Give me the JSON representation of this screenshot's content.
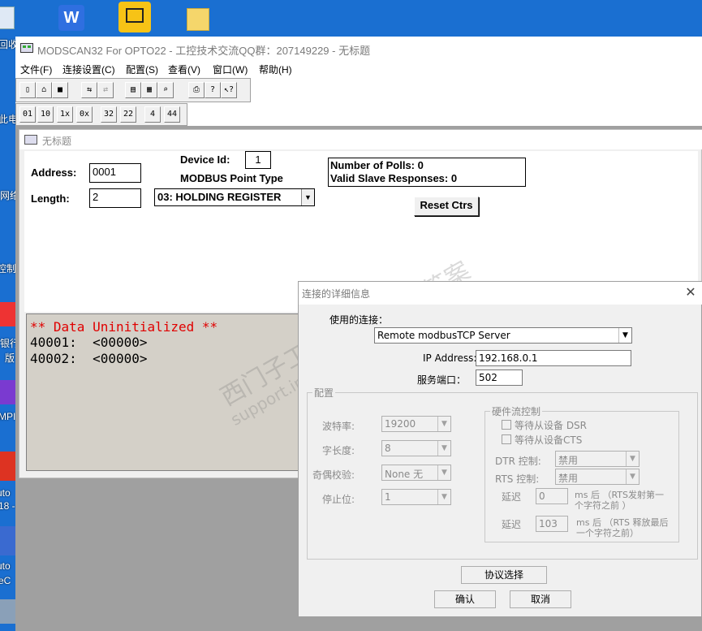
{
  "app": {
    "title": "MODSCAN32 For OPTO22 - 工控技术交流QQ群：207149229 - 无标题",
    "menu": [
      "文件(F)",
      "连接设置(C)",
      "配置(S)",
      "查看(V)",
      "窗口(W)",
      "帮助(H)"
    ],
    "toolbar2_labels": [
      "01",
      "10",
      "1x",
      "0x",
      "32",
      "22",
      "4",
      "44"
    ]
  },
  "desktop": {
    "labels": [
      "回收",
      "此电",
      "网络",
      "控制面",
      "银行",
      "版",
      "MPI",
      "uto",
      "18 -",
      "uto",
      "eC"
    ]
  },
  "child": {
    "title": "无标题",
    "address_label": "Address:",
    "address_value": "0001",
    "length_label": "Length:",
    "length_value": "2",
    "device_id_label": "Device Id:",
    "device_id_value": "1",
    "point_type_label": "MODBUS Point Type",
    "point_type_value": "03: HOLDING REGISTER",
    "polls": "Number of Polls: 0",
    "valid_responses": "Valid Slave Responses: 0",
    "reset_button": "Reset Ctrs",
    "data_status": "** Data Uninitialized **",
    "rows": [
      "40001:  <00000>",
      "40002:  <00000>"
    ]
  },
  "dialog": {
    "title": "连接的详细信息",
    "connection_label": "使用的连接：",
    "connection_value": "Remote modbusTCP Server",
    "ip_label": "IP Address:",
    "ip_value": "192.168.0.1",
    "port_label": "服务端口：",
    "port_value": "502",
    "config_group": "配置",
    "baud_label": "波特率:",
    "baud_value": "19200",
    "wordlen_label": "字长度:",
    "wordlen_value": "8",
    "parity_label": "奇偶校验:",
    "parity_value": "None 无",
    "stopbit_label": "停止位:",
    "stopbit_value": "1",
    "hw_group": "硬件流控制",
    "dsr_label": "等待从设备 DSR",
    "cts_label": "等待从设备CTS",
    "dtr_label": "DTR 控制:",
    "dtr_value": "禁用",
    "rts_label": "RTS 控制:",
    "rts_value": "禁用",
    "delay1_label": "延迟",
    "delay1_value": "0",
    "delay1_note": "ms 后 （RTS发射第一个字符之前 ）",
    "delay2_label": "延迟",
    "delay2_value": "103",
    "delay2_note": "ms 后 （RTS 释放最后一个字符之前）",
    "protocol_button": "协议选择",
    "ok_button": "确认",
    "cancel_button": "取消"
  },
  "watermark": {
    "line1": "西门子工业",
    "line2": "support.industry.siemens.com/cs",
    "line3": "找答案"
  }
}
